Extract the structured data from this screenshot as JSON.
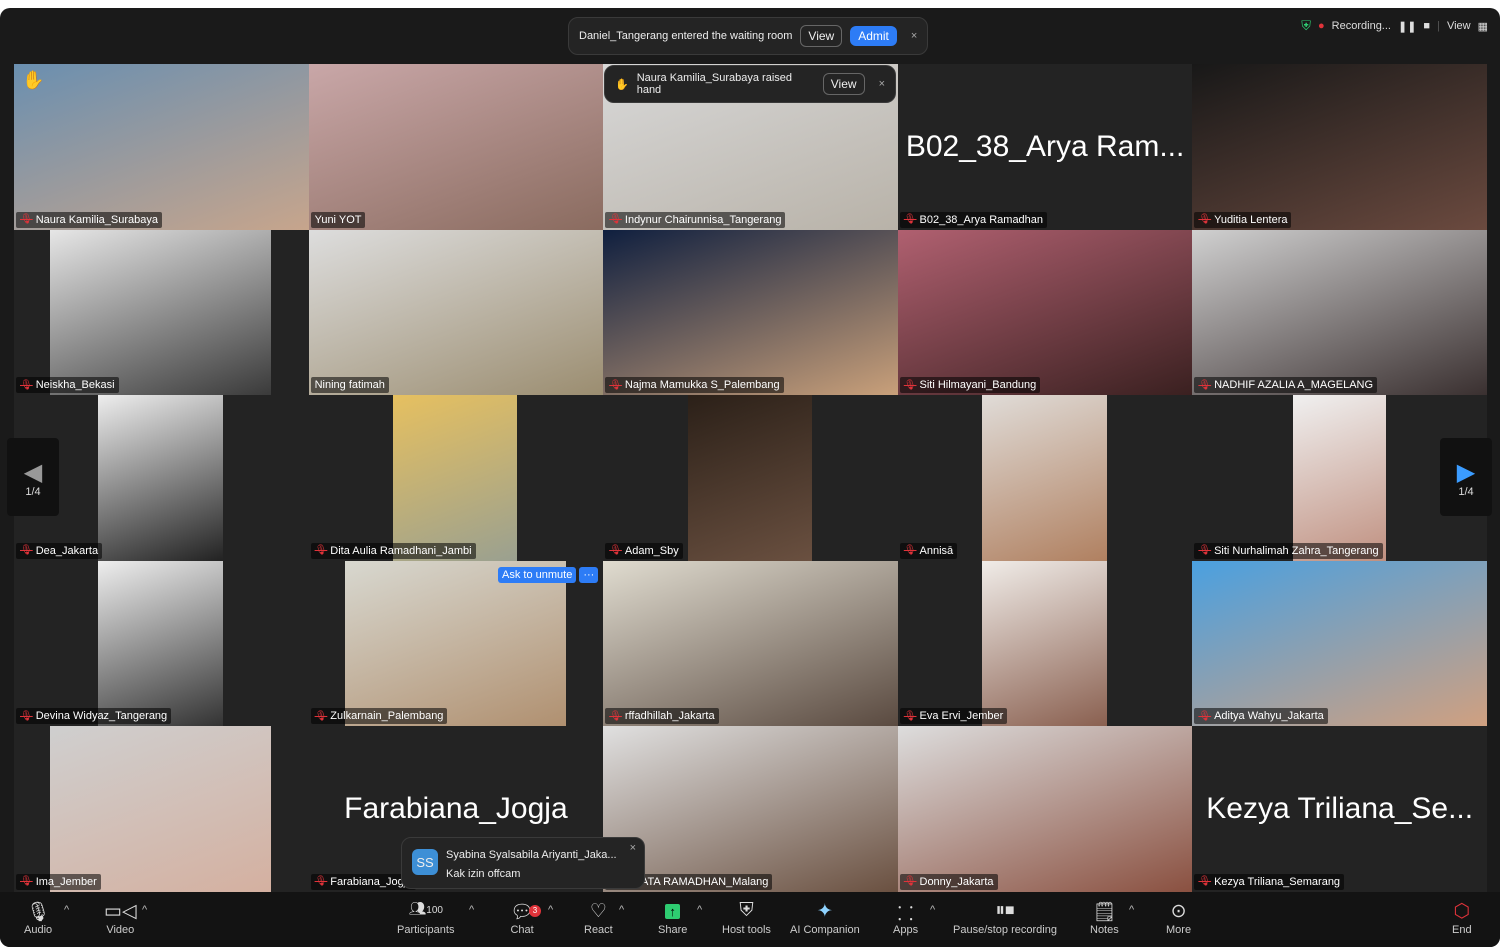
{
  "notifications": {
    "waiting_room": {
      "text": "Daniel_Tangerang entered the waiting room",
      "view": "View",
      "admit": "Admit",
      "close": "×"
    },
    "raised_hand": {
      "text": "Naura Kamilia_Surabaya raised hand",
      "view": "View",
      "close": "×"
    },
    "chat": {
      "avatar": "SS",
      "sender": "Syabina Syalsabila Ariyanti_Jaka...",
      "message": "Kak izin offcam",
      "close": "×"
    }
  },
  "status": {
    "recording": "Recording...",
    "view": "View",
    "shield_color": "#2ecc71"
  },
  "pager": {
    "left": "1/4",
    "right": "1/4"
  },
  "ask_unmute": {
    "label": "Ask to unmute",
    "more": "···"
  },
  "tiles": [
    {
      "name": "Naura Kamilia_Surabaya",
      "muted": true,
      "hand": true
    },
    {
      "name": "Yuni YOT",
      "muted": false,
      "active": true
    },
    {
      "name": "Indynur Chairunnisa_Tangerang",
      "muted": true
    },
    {
      "name": "B02_38_Arya Ramadhan",
      "muted": true,
      "display": "B02_38_Arya Ram..."
    },
    {
      "name": "Yuditia Lentera",
      "muted": true
    },
    {
      "name": "Neiskha_Bekasi",
      "muted": true
    },
    {
      "name": "Nining fatimah",
      "muted": false
    },
    {
      "name": "Najma Mamukka S_Palembang",
      "muted": true
    },
    {
      "name": "Siti Hilmayani_Bandung",
      "muted": true
    },
    {
      "name": "NADHIF AZALIA A_MAGELANG",
      "muted": true
    },
    {
      "name": "Dea_Jakarta",
      "muted": true
    },
    {
      "name": "Dita Aulia Ramadhani_Jambi",
      "muted": true
    },
    {
      "name": "Adam_Sby",
      "muted": true
    },
    {
      "name": "Annisā",
      "muted": true
    },
    {
      "name": "Siti Nurhalimah Zahra_Tangerang",
      "muted": true
    },
    {
      "name": "Devina Widyaz_Tangerang",
      "muted": true
    },
    {
      "name": "Zulkarnain_Palembang",
      "muted": true
    },
    {
      "name": "rffadhillah_Jakarta",
      "muted": true
    },
    {
      "name": "Eva Ervi_Jember",
      "muted": true
    },
    {
      "name": "Aditya Wahyu_Jakarta",
      "muted": true
    },
    {
      "name": "Ima_Jember",
      "muted": true
    },
    {
      "name": "Farabiana_Jogja",
      "muted": true,
      "display": "Farabiana_Jogja"
    },
    {
      "name": "PERMATA RAMADHAN_Malang",
      "muted": false
    },
    {
      "name": "Donny_Jakarta",
      "muted": true
    },
    {
      "name": "Kezya Triliana_Semarang",
      "muted": true,
      "display": "Kezya Triliana_Se..."
    }
  ],
  "toolbar": {
    "audio": "Audio",
    "video": "Video",
    "participants": "Participants",
    "participant_count": "100",
    "chat": "Chat",
    "chat_badge": "3",
    "react": "React",
    "share": "Share",
    "host_tools": "Host tools",
    "ai": "AI Companion",
    "apps": "Apps",
    "recording": "Pause/stop recording",
    "notes": "Notes",
    "more": "More",
    "end": "End"
  }
}
